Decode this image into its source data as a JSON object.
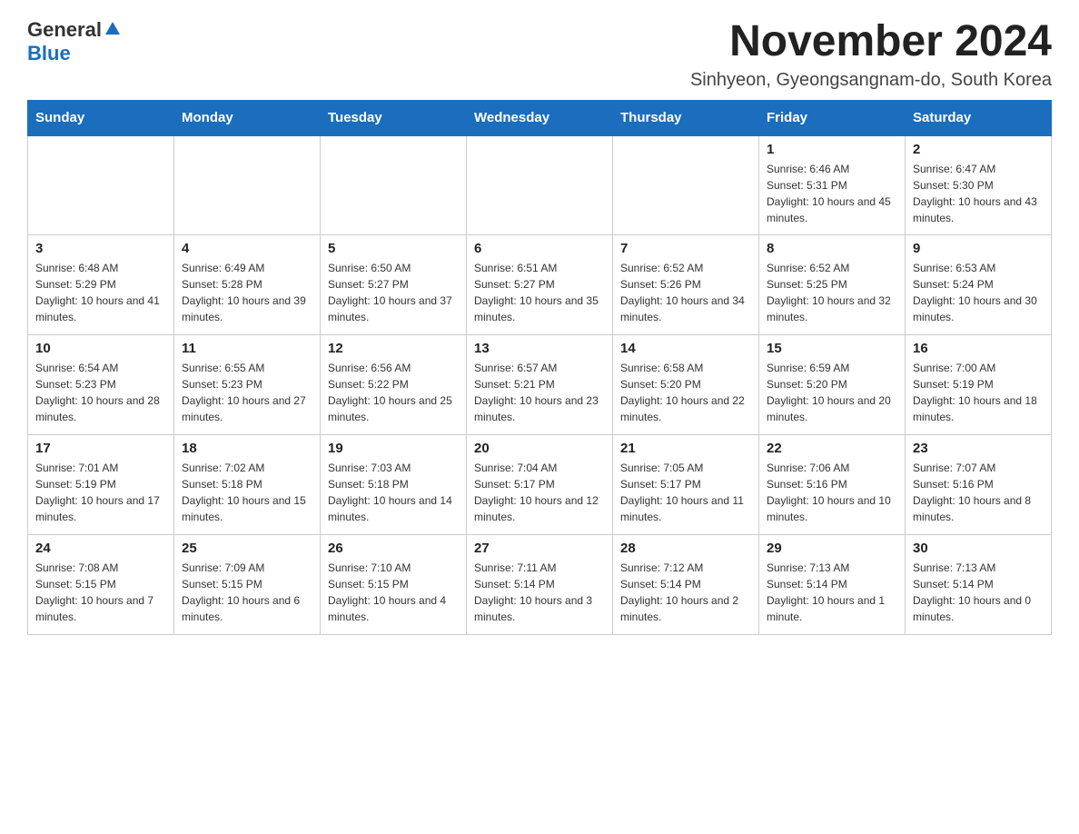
{
  "header": {
    "logo_general": "General",
    "logo_blue": "Blue",
    "title": "November 2024",
    "subtitle": "Sinhyeon, Gyeongsangnam-do, South Korea"
  },
  "weekdays": [
    "Sunday",
    "Monday",
    "Tuesday",
    "Wednesday",
    "Thursday",
    "Friday",
    "Saturday"
  ],
  "weeks": [
    [
      {
        "day": "",
        "sunrise": "",
        "sunset": "",
        "daylight": ""
      },
      {
        "day": "",
        "sunrise": "",
        "sunset": "",
        "daylight": ""
      },
      {
        "day": "",
        "sunrise": "",
        "sunset": "",
        "daylight": ""
      },
      {
        "day": "",
        "sunrise": "",
        "sunset": "",
        "daylight": ""
      },
      {
        "day": "",
        "sunrise": "",
        "sunset": "",
        "daylight": ""
      },
      {
        "day": "1",
        "sunrise": "Sunrise: 6:46 AM",
        "sunset": "Sunset: 5:31 PM",
        "daylight": "Daylight: 10 hours and 45 minutes."
      },
      {
        "day": "2",
        "sunrise": "Sunrise: 6:47 AM",
        "sunset": "Sunset: 5:30 PM",
        "daylight": "Daylight: 10 hours and 43 minutes."
      }
    ],
    [
      {
        "day": "3",
        "sunrise": "Sunrise: 6:48 AM",
        "sunset": "Sunset: 5:29 PM",
        "daylight": "Daylight: 10 hours and 41 minutes."
      },
      {
        "day": "4",
        "sunrise": "Sunrise: 6:49 AM",
        "sunset": "Sunset: 5:28 PM",
        "daylight": "Daylight: 10 hours and 39 minutes."
      },
      {
        "day": "5",
        "sunrise": "Sunrise: 6:50 AM",
        "sunset": "Sunset: 5:27 PM",
        "daylight": "Daylight: 10 hours and 37 minutes."
      },
      {
        "day": "6",
        "sunrise": "Sunrise: 6:51 AM",
        "sunset": "Sunset: 5:27 PM",
        "daylight": "Daylight: 10 hours and 35 minutes."
      },
      {
        "day": "7",
        "sunrise": "Sunrise: 6:52 AM",
        "sunset": "Sunset: 5:26 PM",
        "daylight": "Daylight: 10 hours and 34 minutes."
      },
      {
        "day": "8",
        "sunrise": "Sunrise: 6:52 AM",
        "sunset": "Sunset: 5:25 PM",
        "daylight": "Daylight: 10 hours and 32 minutes."
      },
      {
        "day": "9",
        "sunrise": "Sunrise: 6:53 AM",
        "sunset": "Sunset: 5:24 PM",
        "daylight": "Daylight: 10 hours and 30 minutes."
      }
    ],
    [
      {
        "day": "10",
        "sunrise": "Sunrise: 6:54 AM",
        "sunset": "Sunset: 5:23 PM",
        "daylight": "Daylight: 10 hours and 28 minutes."
      },
      {
        "day": "11",
        "sunrise": "Sunrise: 6:55 AM",
        "sunset": "Sunset: 5:23 PM",
        "daylight": "Daylight: 10 hours and 27 minutes."
      },
      {
        "day": "12",
        "sunrise": "Sunrise: 6:56 AM",
        "sunset": "Sunset: 5:22 PM",
        "daylight": "Daylight: 10 hours and 25 minutes."
      },
      {
        "day": "13",
        "sunrise": "Sunrise: 6:57 AM",
        "sunset": "Sunset: 5:21 PM",
        "daylight": "Daylight: 10 hours and 23 minutes."
      },
      {
        "day": "14",
        "sunrise": "Sunrise: 6:58 AM",
        "sunset": "Sunset: 5:20 PM",
        "daylight": "Daylight: 10 hours and 22 minutes."
      },
      {
        "day": "15",
        "sunrise": "Sunrise: 6:59 AM",
        "sunset": "Sunset: 5:20 PM",
        "daylight": "Daylight: 10 hours and 20 minutes."
      },
      {
        "day": "16",
        "sunrise": "Sunrise: 7:00 AM",
        "sunset": "Sunset: 5:19 PM",
        "daylight": "Daylight: 10 hours and 18 minutes."
      }
    ],
    [
      {
        "day": "17",
        "sunrise": "Sunrise: 7:01 AM",
        "sunset": "Sunset: 5:19 PM",
        "daylight": "Daylight: 10 hours and 17 minutes."
      },
      {
        "day": "18",
        "sunrise": "Sunrise: 7:02 AM",
        "sunset": "Sunset: 5:18 PM",
        "daylight": "Daylight: 10 hours and 15 minutes."
      },
      {
        "day": "19",
        "sunrise": "Sunrise: 7:03 AM",
        "sunset": "Sunset: 5:18 PM",
        "daylight": "Daylight: 10 hours and 14 minutes."
      },
      {
        "day": "20",
        "sunrise": "Sunrise: 7:04 AM",
        "sunset": "Sunset: 5:17 PM",
        "daylight": "Daylight: 10 hours and 12 minutes."
      },
      {
        "day": "21",
        "sunrise": "Sunrise: 7:05 AM",
        "sunset": "Sunset: 5:17 PM",
        "daylight": "Daylight: 10 hours and 11 minutes."
      },
      {
        "day": "22",
        "sunrise": "Sunrise: 7:06 AM",
        "sunset": "Sunset: 5:16 PM",
        "daylight": "Daylight: 10 hours and 10 minutes."
      },
      {
        "day": "23",
        "sunrise": "Sunrise: 7:07 AM",
        "sunset": "Sunset: 5:16 PM",
        "daylight": "Daylight: 10 hours and 8 minutes."
      }
    ],
    [
      {
        "day": "24",
        "sunrise": "Sunrise: 7:08 AM",
        "sunset": "Sunset: 5:15 PM",
        "daylight": "Daylight: 10 hours and 7 minutes."
      },
      {
        "day": "25",
        "sunrise": "Sunrise: 7:09 AM",
        "sunset": "Sunset: 5:15 PM",
        "daylight": "Daylight: 10 hours and 6 minutes."
      },
      {
        "day": "26",
        "sunrise": "Sunrise: 7:10 AM",
        "sunset": "Sunset: 5:15 PM",
        "daylight": "Daylight: 10 hours and 4 minutes."
      },
      {
        "day": "27",
        "sunrise": "Sunrise: 7:11 AM",
        "sunset": "Sunset: 5:14 PM",
        "daylight": "Daylight: 10 hours and 3 minutes."
      },
      {
        "day": "28",
        "sunrise": "Sunrise: 7:12 AM",
        "sunset": "Sunset: 5:14 PM",
        "daylight": "Daylight: 10 hours and 2 minutes."
      },
      {
        "day": "29",
        "sunrise": "Sunrise: 7:13 AM",
        "sunset": "Sunset: 5:14 PM",
        "daylight": "Daylight: 10 hours and 1 minute."
      },
      {
        "day": "30",
        "sunrise": "Sunrise: 7:13 AM",
        "sunset": "Sunset: 5:14 PM",
        "daylight": "Daylight: 10 hours and 0 minutes."
      }
    ]
  ]
}
